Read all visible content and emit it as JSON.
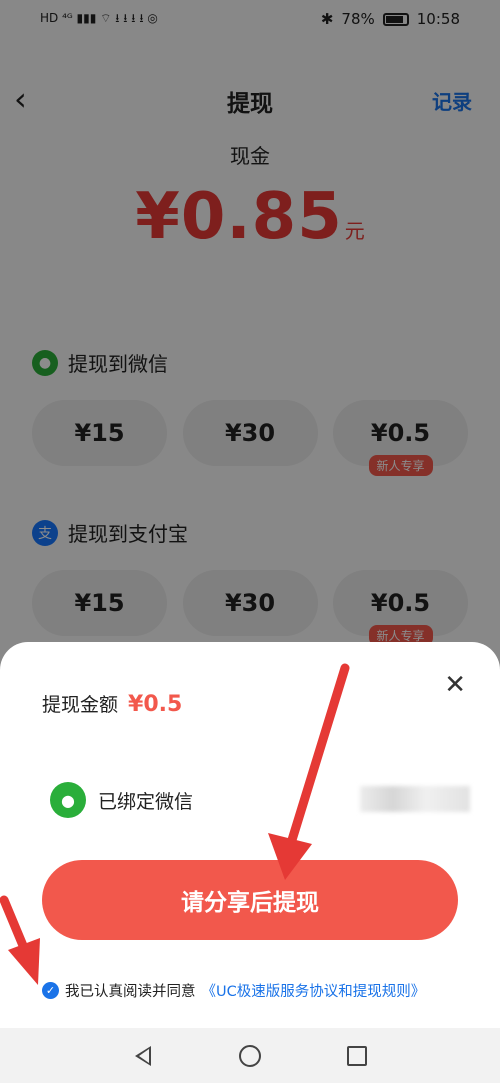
{
  "status_bar": {
    "left_indicators": "HD ⁴ᴳ ▮▮▮ ⌔ ⭳ ⭳ ⭳ ⭳ ◎",
    "battery": "78%",
    "time": "10:58"
  },
  "header": {
    "back_icon": "chevron-left",
    "title": "提现",
    "record": "记录"
  },
  "balance": {
    "label": "现金",
    "amount": "¥0.85",
    "unit": "元"
  },
  "wechat_section": {
    "title": "提现到微信",
    "options": [
      {
        "label": "¥15",
        "tag": ""
      },
      {
        "label": "¥30",
        "tag": ""
      },
      {
        "label": "¥0.5",
        "tag": "新人专享"
      }
    ]
  },
  "alipay_section": {
    "title": "提现到支付宝",
    "options": [
      {
        "label": "¥15",
        "tag": ""
      },
      {
        "label": "¥30",
        "tag": ""
      },
      {
        "label": "¥0.5",
        "tag": "新人专享"
      }
    ]
  },
  "sheet": {
    "amount_label": "提现金额",
    "amount_value": "¥0.5",
    "bound_label": "已绑定微信",
    "share_button": "请分享后提现",
    "agree_text": "我已认真阅读并同意",
    "agree_link": "《UC极速版服务协议和提现规则》"
  },
  "colors": {
    "accent_red": "#f2584c",
    "link_blue": "#1a73e8",
    "wechat_green": "#2aae3a",
    "arrow_red": "#e53935"
  }
}
